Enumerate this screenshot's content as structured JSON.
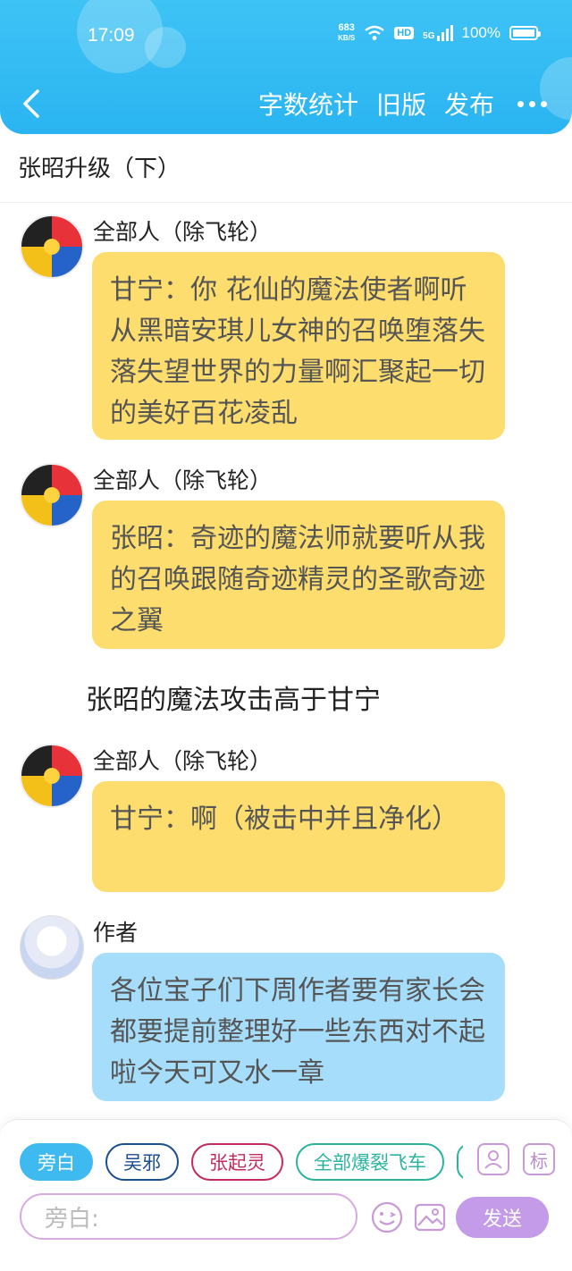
{
  "status_bar": {
    "time": "17:09",
    "net_speed_value": "683",
    "net_speed_unit": "KB/S",
    "hd": "HD",
    "signal": "5G",
    "battery": "100%"
  },
  "nav": {
    "actions": [
      "字数统计",
      "旧版",
      "发布"
    ],
    "more_icon": "more-dots-icon",
    "back_icon": "chevron-left-icon"
  },
  "chapter": {
    "title": "张昭升级（下）"
  },
  "messages": [
    {
      "sender": "全部人（除飞轮）",
      "text": "甘宁：你 花仙的魔法使者啊听从黑暗安琪儿女神的召唤堕落失落失望世界的力量啊汇聚起一切的美好百花凌乱",
      "color": "#fddd6e"
    },
    {
      "sender": "全部人（除飞轮）",
      "text": "张昭：奇迹的魔法师就要听从我的召唤跟随奇迹精灵的圣歌奇迹之翼",
      "color": "#fddd6e"
    },
    {
      "narration": "张昭的魔法攻击高于甘宁"
    },
    {
      "sender": "全部人（除飞轮）",
      "text": "甘宁：啊（被击中并且净化）",
      "color": "#fddd6e"
    },
    {
      "sender": "作者",
      "text": "各位宝子们下周作者要有家长会都要提前整理好一些东西对不起啦今天可又水一章",
      "color": "#a6ddfb"
    }
  ],
  "composer": {
    "roles": [
      "旁白",
      "吴邪",
      "张起灵",
      "全部爆裂飞车"
    ],
    "active_role": "旁白",
    "mark_label": "标",
    "placeholder": "旁白:",
    "send_label": "发送",
    "icons": [
      "role-select-icon",
      "emoji-icon",
      "image-icon"
    ]
  },
  "colors": {
    "header": "#2ab4f1",
    "bubble_yellow": "#fddd6e",
    "bubble_blue": "#a6ddfb",
    "send": "#c49be8"
  }
}
